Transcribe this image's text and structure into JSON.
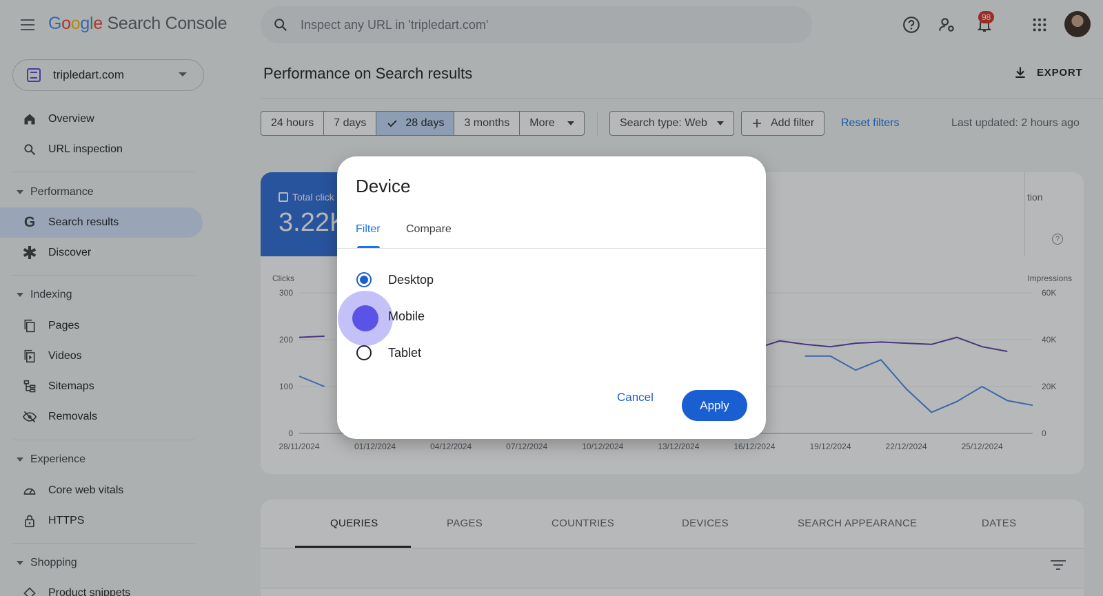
{
  "header": {
    "menu_icon": "hamburger-menu-icon",
    "brand_letters": [
      "G",
      "o",
      "o",
      "g",
      "l",
      "e"
    ],
    "brand_product": "Search Console",
    "search_placeholder": "Inspect any URL in 'tripledart.com'",
    "notification_count": "98"
  },
  "property": {
    "name": "tripledart.com"
  },
  "sidebar": {
    "items": [
      {
        "label": "Overview",
        "icon": "home-icon"
      },
      {
        "label": "URL inspection",
        "icon": "search-icon"
      },
      {
        "label": "Search results",
        "icon": "google-g-icon"
      },
      {
        "label": "Discover",
        "icon": "asterisk-icon"
      },
      {
        "label": "Pages",
        "icon": "pages-icon"
      },
      {
        "label": "Videos",
        "icon": "video-icon"
      },
      {
        "label": "Sitemaps",
        "icon": "sitemap-icon"
      },
      {
        "label": "Removals",
        "icon": "eye-off-icon"
      },
      {
        "label": "Core web vitals",
        "icon": "gauge-icon"
      },
      {
        "label": "HTTPS",
        "icon": "lock-icon"
      },
      {
        "label": "Product snippets",
        "icon": "diamond-icon"
      }
    ],
    "sections": [
      "Performance",
      "Indexing",
      "Experience",
      "Shopping"
    ]
  },
  "main": {
    "title": "Performance on Search results",
    "export_label": "EXPORT",
    "ranges": [
      "24 hours",
      "7 days",
      "28 days",
      "3 months",
      "More"
    ],
    "selected_range": "28 days",
    "search_type": "Search type: Web",
    "add_filter": "Add filter",
    "reset_filters": "Reset filters",
    "last_updated": "Last updated: 2 hours ago"
  },
  "metrics": {
    "clicks_label": "Total click",
    "clicks_value": "3.22K",
    "tail_label": "tion"
  },
  "chart_data": {
    "type": "line",
    "y_left_label": "Clicks",
    "y_right_label": "Impressions",
    "y_left_ticks": [
      "300",
      "200",
      "100",
      "0"
    ],
    "y_right_ticks": [
      "60K",
      "40K",
      "20K",
      "0"
    ],
    "ylim_left": [
      0,
      300
    ],
    "ylim_right": [
      0,
      60000
    ],
    "x_tick_labels": [
      "28/11/2024",
      "01/12/2024",
      "04/12/2024",
      "07/12/2024",
      "10/12/2024",
      "13/12/2024",
      "16/12/2024",
      "19/12/2024",
      "22/12/2024",
      "25/12/2024"
    ],
    "series": [
      {
        "name": "Clicks",
        "color": "#4a86e8",
        "axis": "left",
        "points": [
          [
            0,
            122
          ],
          [
            1,
            100
          ],
          [
            18,
            80
          ],
          [
            20,
            165
          ],
          [
            21,
            165
          ],
          [
            22,
            135
          ],
          [
            23,
            157
          ],
          [
            24,
            95
          ],
          [
            25,
            45
          ],
          [
            26,
            68
          ],
          [
            27,
            100
          ],
          [
            28,
            70
          ],
          [
            29,
            60
          ]
        ]
      },
      {
        "name": "Impressions",
        "color": "#5e3ea8",
        "axis": "right",
        "points": [
          [
            0,
            41000
          ],
          [
            1,
            41500
          ],
          [
            18,
            36000
          ],
          [
            19,
            39500
          ],
          [
            20,
            38000
          ],
          [
            21,
            37000
          ],
          [
            22,
            38500
          ],
          [
            23,
            39000
          ],
          [
            24,
            38500
          ],
          [
            25,
            38000
          ],
          [
            26,
            41000
          ],
          [
            27,
            37000
          ],
          [
            28,
            35000
          ]
        ]
      }
    ]
  },
  "report_tabs": [
    "QUERIES",
    "PAGES",
    "COUNTRIES",
    "DEVICES",
    "SEARCH APPEARANCE",
    "DATES"
  ],
  "dialog": {
    "title": "Device",
    "tabs": [
      "Filter",
      "Compare"
    ],
    "options": [
      "Desktop",
      "Mobile",
      "Tablet"
    ],
    "selected_option": "Desktop",
    "cancel": "Cancel",
    "apply": "Apply"
  }
}
